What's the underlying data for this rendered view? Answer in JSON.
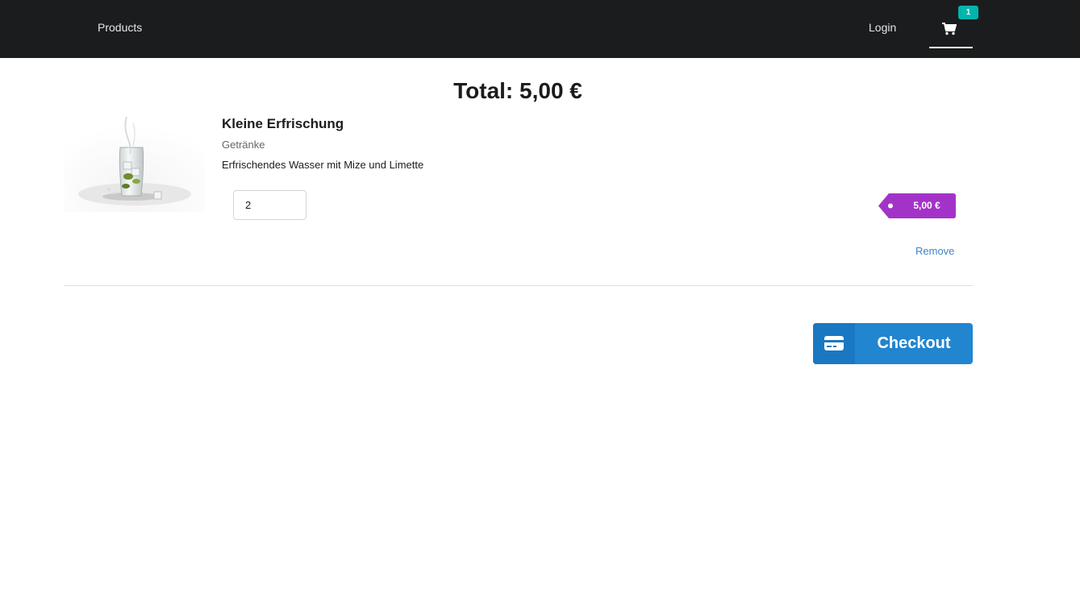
{
  "nav": {
    "products_label": "Products",
    "login_label": "Login",
    "cart_count": "1",
    "cart_icon": "shopping-cart-icon"
  },
  "cart": {
    "total_label": "Total: 5,00 €",
    "items": [
      {
        "name": "Kleine Erfrischung",
        "category": "Getränke",
        "description": "Erfrischendes Wasser mit Mize und Limette",
        "quantity": "2",
        "price": "5,00 €",
        "remove_label": "Remove"
      }
    ]
  },
  "checkout": {
    "label": "Checkout",
    "icon": "credit-card-icon"
  },
  "colors": {
    "navbar": "#1b1c1d",
    "badge": "#00b5ad",
    "price_tag": "#a333c8",
    "link": "#4183c4",
    "checkout": "#2185d0"
  }
}
